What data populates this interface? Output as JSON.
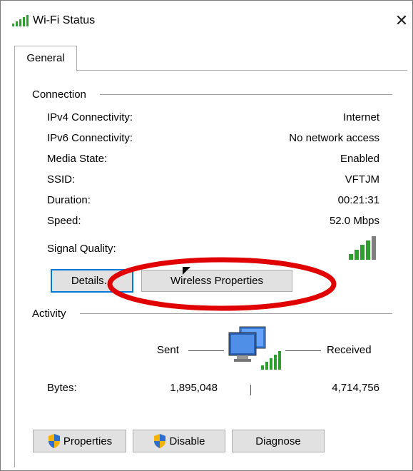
{
  "window": {
    "title": "Wi-Fi Status",
    "title_icon": "wifi-signal-bars-icon",
    "close_glyph": "✕"
  },
  "tabs": [
    {
      "label": "General",
      "selected": true
    }
  ],
  "connection": {
    "group_label": "Connection",
    "rows": [
      {
        "label": "IPv4 Connectivity:",
        "value": "Internet"
      },
      {
        "label": "IPv6 Connectivity:",
        "value": "No network access"
      },
      {
        "label": "Media State:",
        "value": "Enabled"
      },
      {
        "label": "SSID:",
        "value": "VFTJM"
      },
      {
        "label": "Duration:",
        "value": "00:21:31"
      },
      {
        "label": "Speed:",
        "value": "52.0 Mbps"
      }
    ],
    "signal_label": "Signal Quality:",
    "signal_bars_lit": 4,
    "signal_bars_total": 5,
    "details_button": "Details...",
    "wireless_properties_button": "Wireless Properties"
  },
  "activity": {
    "group_label": "Activity",
    "sent_label": "Sent",
    "received_label": "Received",
    "bytes_label": "Bytes:",
    "bytes_sent": "1,895,048",
    "bytes_received": "4,714,756"
  },
  "buttons": {
    "properties": "Properties",
    "disable": "Disable",
    "diagnose": "Diagnose"
  },
  "colors": {
    "signal_green": "#2e9e2e",
    "signal_gray": "#7f7f7f",
    "annotation_red": "#e00000",
    "focus_blue": "#0078d7",
    "button_face": "#e1e1e1"
  }
}
